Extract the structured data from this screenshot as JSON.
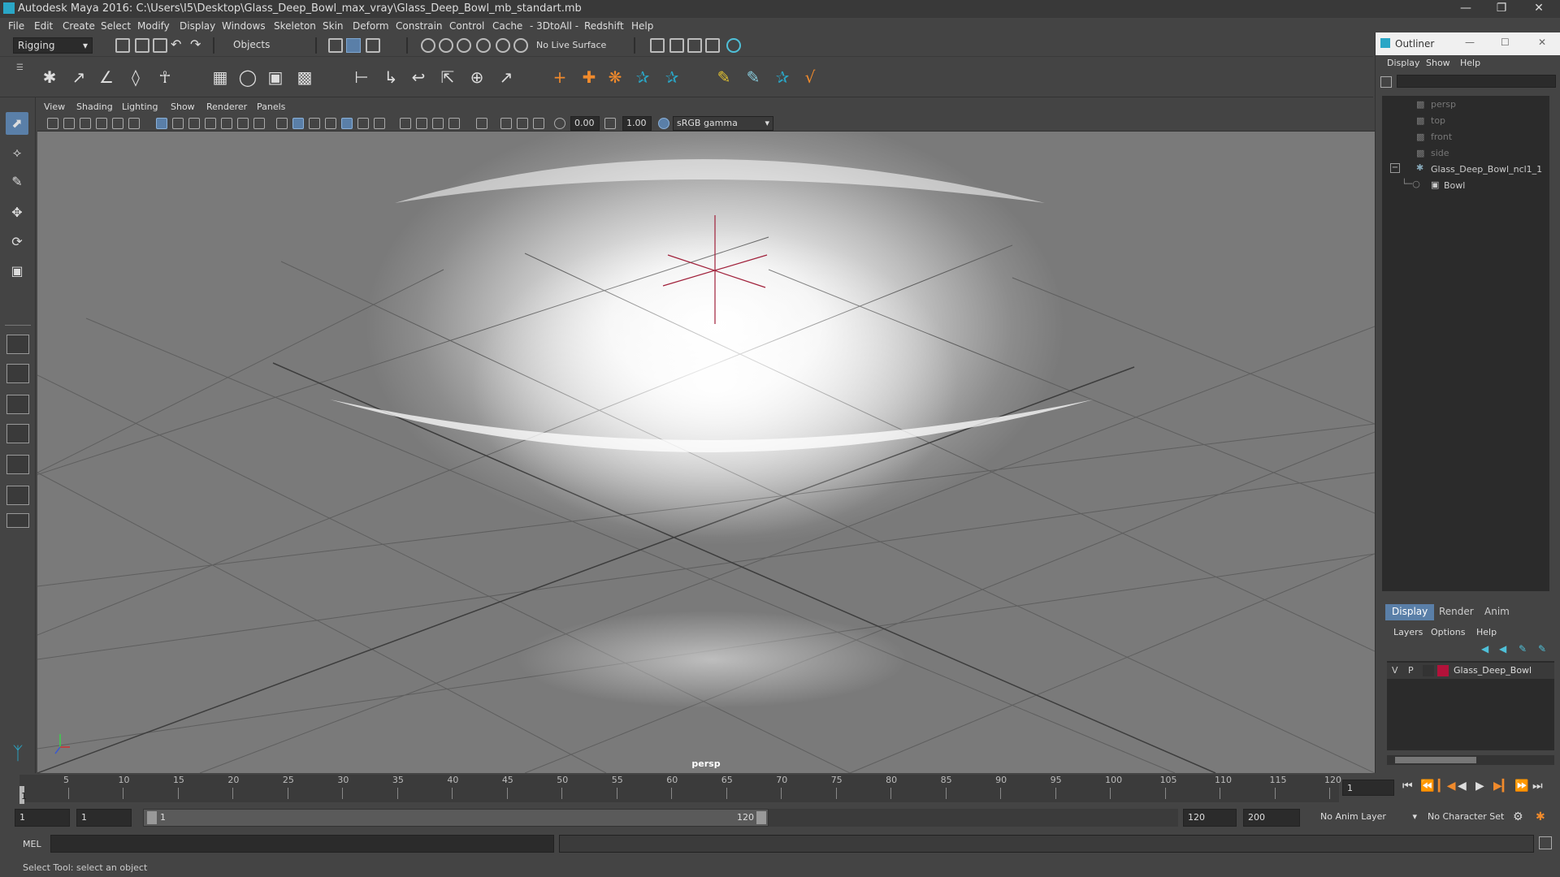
{
  "window": {
    "title": "Autodesk Maya 2016: C:\\Users\\I5\\Desktop\\Glass_Deep_Bowl_max_vray\\Glass_Deep_Bowl_mb_standart.mb",
    "minimize": "—",
    "maximize": "❐",
    "close": "✕"
  },
  "menubar": [
    "File",
    "Edit",
    "Create",
    "Select",
    "Modify",
    "Display",
    "Windows",
    "Skeleton",
    "Skin",
    "Deform",
    "Constrain",
    "Control",
    "Cache",
    "- 3DtoAll -",
    "Redshift",
    "Help"
  ],
  "statusline": {
    "menuset": "Rigging",
    "selmode": "Objects",
    "live_surface": "No Live Surface"
  },
  "viewport": {
    "menu": [
      "View",
      "Shading",
      "Lighting",
      "Show",
      "Renderer",
      "Panels"
    ],
    "exposure": "0.00",
    "gamma": "1.00",
    "colorspace": "sRGB gamma",
    "camera": "persp"
  },
  "timeline": {
    "ticks": [
      "5",
      "10",
      "15",
      "20",
      "25",
      "30",
      "35",
      "40",
      "45",
      "50",
      "55",
      "60",
      "65",
      "70",
      "75",
      "80",
      "85",
      "90",
      "95",
      "100",
      "105",
      "110",
      "115",
      "120"
    ],
    "current_frame": "1",
    "start_marker": "1"
  },
  "range": {
    "start": "1",
    "playback_start": "1",
    "slider_start": "1",
    "slider_end": "120",
    "playback_end": "120",
    "end": "200",
    "anim_layer": "No Anim Layer",
    "char_set": "No Character Set"
  },
  "commandline": {
    "label": "MEL"
  },
  "helpline": "Select Tool: select an object",
  "outliner": {
    "title": "Outliner",
    "menu": [
      "Display",
      "Show",
      "Help"
    ],
    "items": [
      {
        "label": "persp",
        "dim": true
      },
      {
        "label": "top",
        "dim": true
      },
      {
        "label": "front",
        "dim": true
      },
      {
        "label": "side",
        "dim": true
      },
      {
        "label": "Glass_Deep_Bowl_ncl1_1",
        "dim": false
      },
      {
        "label": "Bowl",
        "dim": false
      }
    ]
  },
  "layers": {
    "tabs": [
      "Display",
      "Render",
      "Anim"
    ],
    "menu": [
      "Layers",
      "Options",
      "Help"
    ],
    "row": {
      "v": "V",
      "p": "P",
      "name": "Glass_Deep_Bowl",
      "color": "#b3123a"
    }
  },
  "colors": {
    "accent": "#5a7fa8",
    "maya_teal": "#2aa6c6"
  }
}
